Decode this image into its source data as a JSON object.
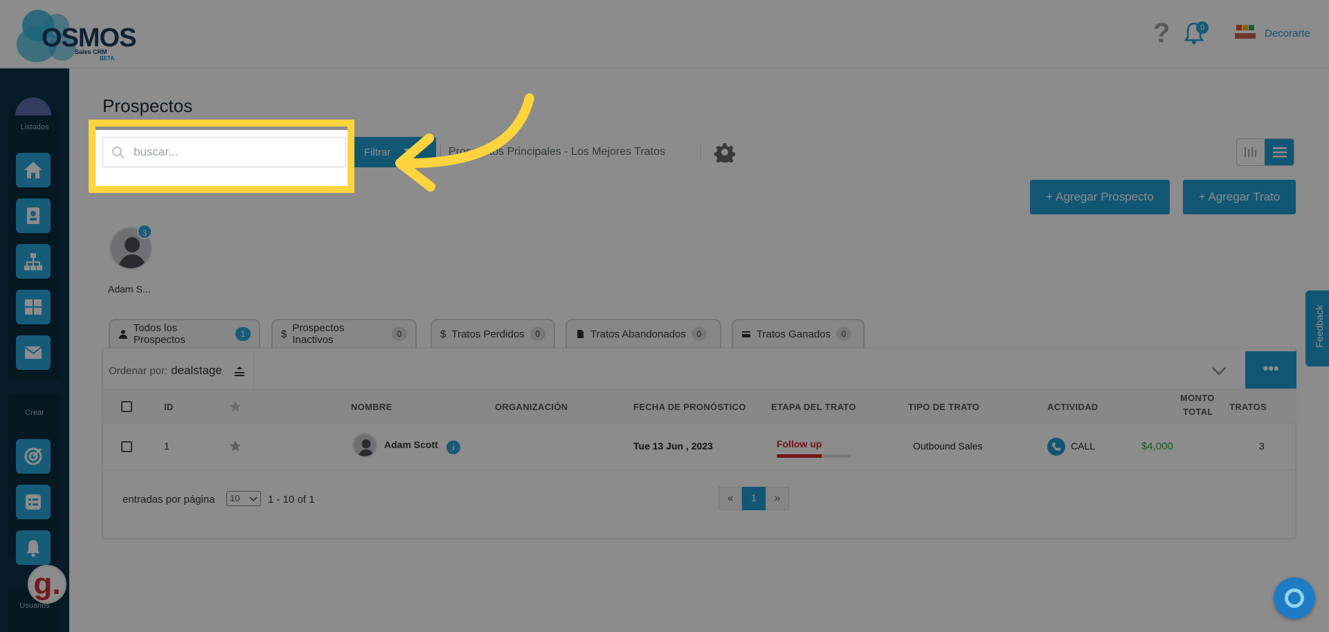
{
  "header": {
    "logo": {
      "brand": "OSMOS",
      "subtitle": "Sales CRM",
      "beta": "BETA"
    },
    "help_symbol": "?",
    "notifications_count": "0",
    "company_name": "Decorarte"
  },
  "sidebar": {
    "section_list_label": "Listados",
    "section_create_label": "Crear",
    "section_users_label": "Usuarios",
    "list_items": [
      {
        "icon": "home-icon"
      },
      {
        "icon": "contact-card-icon"
      },
      {
        "icon": "org-chart-icon"
      },
      {
        "icon": "grid-icon"
      },
      {
        "icon": "mail-icon"
      }
    ],
    "create_items": [
      {
        "icon": "target-icon"
      },
      {
        "icon": "task-list-icon"
      },
      {
        "icon": "alarm-bell-icon"
      }
    ],
    "g_badge": "g."
  },
  "main": {
    "page_title": "Prospectos",
    "search_placeholder": "buscar...",
    "filter_label": "Filtrar",
    "pipeline_name": "Prospectos Principales - Los Mejores Tratos",
    "add_prospect_label": "+ Agregar Prospecto",
    "add_deal_label": "+ Agregar Trato",
    "user": {
      "name": "Adam S...",
      "badge": "3"
    }
  },
  "tabs": [
    {
      "label": "Todos los Prospectos",
      "count": "1",
      "icon": "person-icon"
    },
    {
      "label": "Prospectos Inactivos",
      "count": "0",
      "icon": "dollar-icon"
    },
    {
      "label": "Tratos Perdidos",
      "count": "0",
      "icon": "dollar-icon"
    },
    {
      "label": "Tratos Abandonados",
      "count": "0",
      "icon": "document-icon"
    },
    {
      "label": "Tratos Ganados",
      "count": "0",
      "icon": "card-icon"
    }
  ],
  "sort": {
    "label": "Ordenar por:",
    "value": "dealstage"
  },
  "table": {
    "columns": {
      "id": "ID",
      "name": "NOMBRE",
      "org": "ORGANIZACIÓN",
      "forecast": "FECHA DE PRONÓSTICO",
      "stage": "ETAPA DEL TRATO",
      "type": "TIPO DE TRATO",
      "activity": "ACTIVIDAD",
      "amount_line1": "MONTO",
      "amount_line2": "TOTAL",
      "deals": "TRATOS"
    },
    "rows": [
      {
        "id": "1",
        "name": "Adam Scott",
        "org": "",
        "forecast": "Tue 13 Jun , 2023",
        "stage": "Follow up",
        "stage_progress": 0.6,
        "type": "Outbound Sales",
        "activity": "CALL",
        "amount": "$4,000",
        "deals": "3"
      }
    ]
  },
  "pagination": {
    "per_page_label": "entradas por página",
    "per_page_value": "10",
    "range": "1 - 10 of 1",
    "prev": "«",
    "current": "1",
    "next": "»"
  },
  "feedback_label": "Feedback",
  "colors": {
    "accent": "#1f9fd3",
    "highlight": "#fdd43e",
    "stage_red": "#d0232d",
    "amount_green": "#2aa84a"
  }
}
